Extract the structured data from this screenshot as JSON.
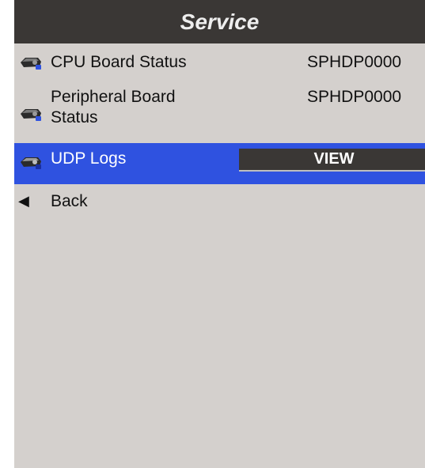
{
  "header": {
    "title": "Service"
  },
  "menu": [
    {
      "label": "CPU Board Status",
      "value": "SPHDP0000",
      "icon": "projector-icon"
    },
    {
      "label_line1": "Peripheral Board",
      "label_line2": "Status",
      "value": "SPHDP0000",
      "icon": "projector-icon"
    },
    {
      "label": "UDP Logs",
      "button": "VIEW",
      "icon": "projector-icon",
      "selected": true
    },
    {
      "label": "Back",
      "icon": "back-arrow-icon"
    }
  ],
  "colors": {
    "header_bg": "#3a3735",
    "panel_bg": "#d4d0cd",
    "selected_bg": "#2f52e0"
  }
}
